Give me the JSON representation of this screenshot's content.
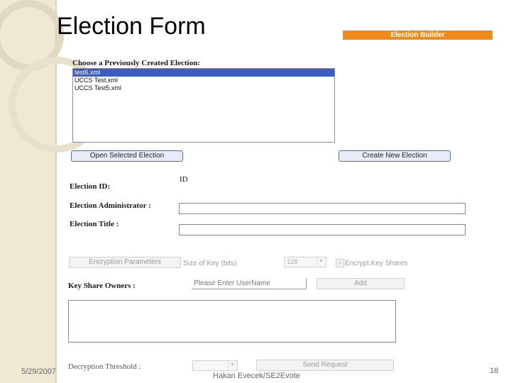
{
  "slide": {
    "title": "Election Form",
    "footer_date": "5/29/2007",
    "footer_author": "Hakan Evecek/SE2Evote",
    "page_number": "18"
  },
  "header_bar": {
    "label": "Election Builder",
    "color": "#f08a1c"
  },
  "election_list": {
    "label": "Choose a Previously Created Election:",
    "items": [
      "test6.xml",
      "UCCS Test.xml",
      "UCCS Test5.xml"
    ],
    "selected_index": 0
  },
  "buttons": {
    "open_selected": "Open Selected Election",
    "create_new": "Create New Election",
    "encryption_parameters": "Encryption Parameters",
    "add": "Add",
    "send_request": "Send Request"
  },
  "fields": {
    "election_id_label": "Election ID:",
    "election_id_value": "ID",
    "election_admin_label": "Election Administrator :",
    "election_title_label": "Election Title :",
    "key_size_label": "Size of Key (bits)",
    "key_size_value": "128",
    "encrypt_shares_label": "Encrypt Key Shares",
    "key_share_owners_label": "Key Share Owners :",
    "user_name_placeholder": "Please Enter UserName",
    "decryption_threshold_label": "Decryption Threshold :"
  }
}
